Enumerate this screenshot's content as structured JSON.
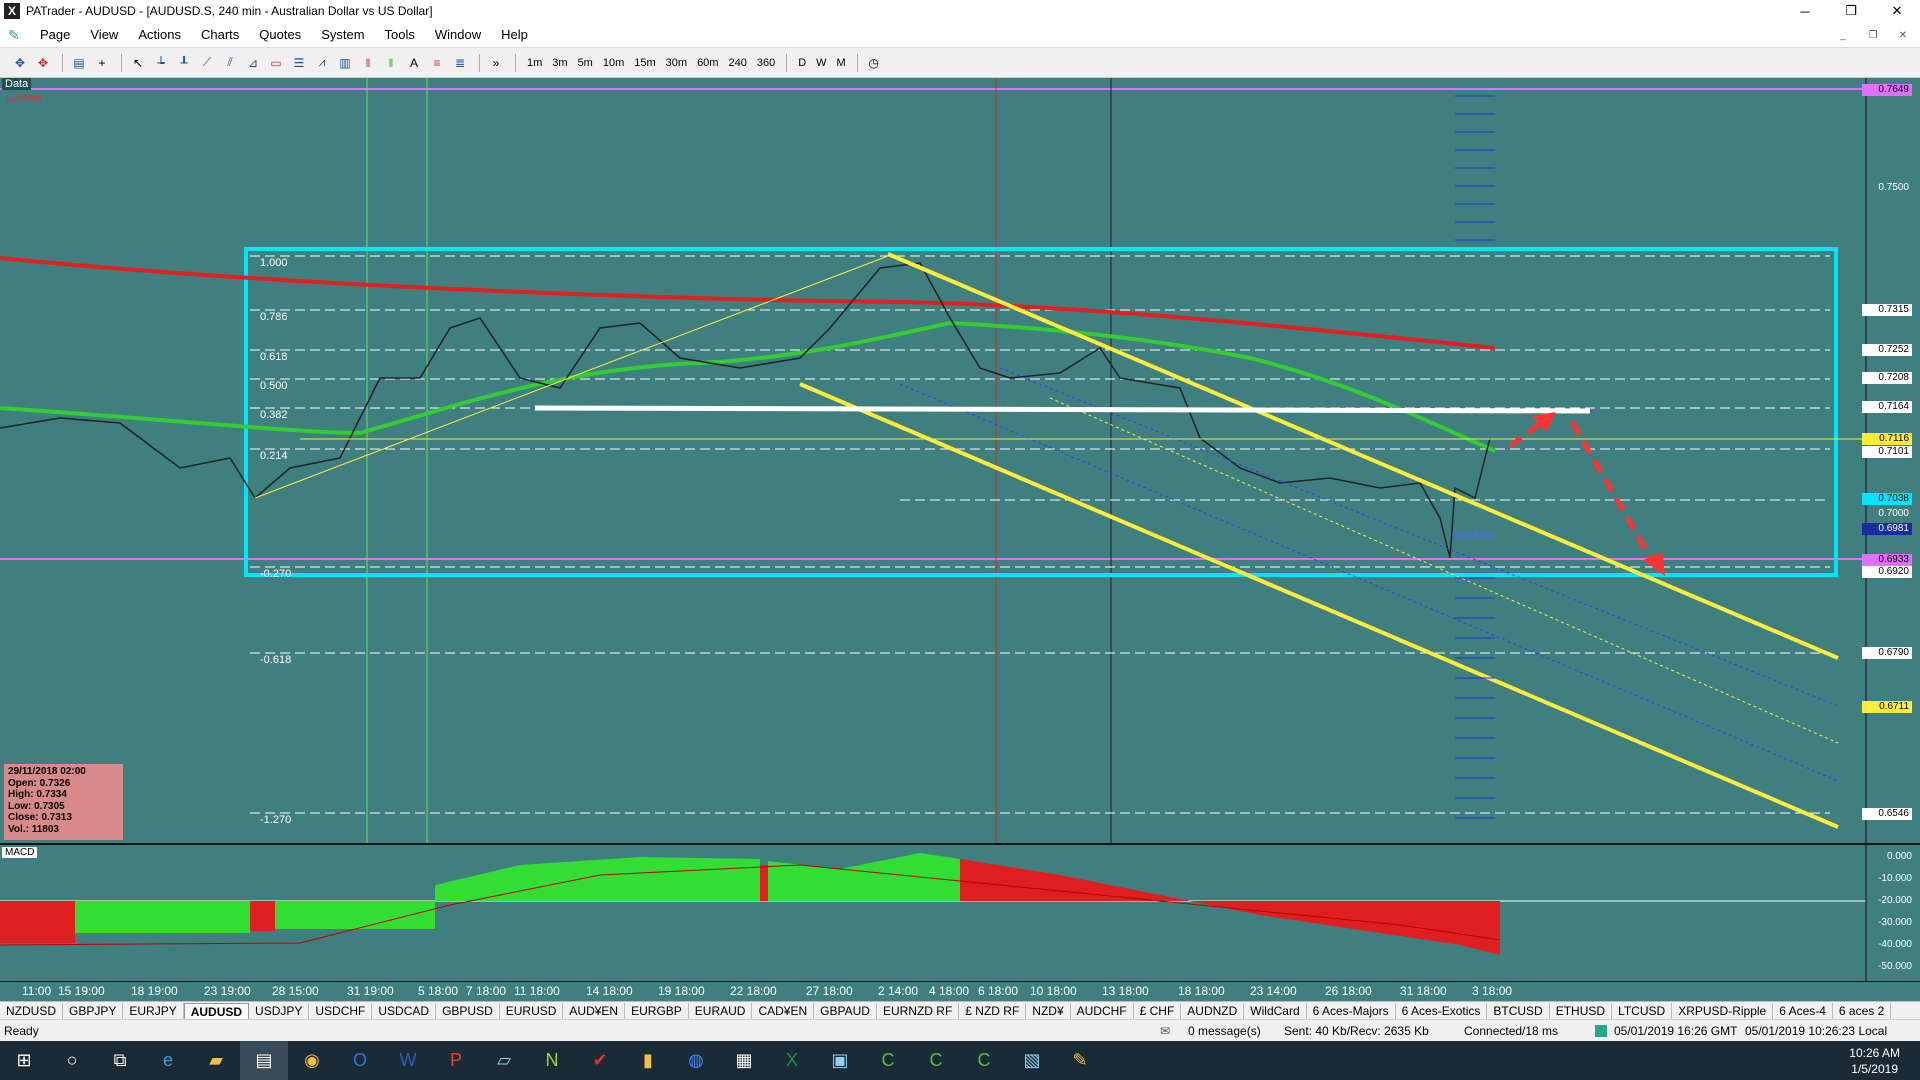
{
  "window": {
    "title": "PATrader - AUDUSD - [AUDUSD.S, 240 min - Australian Dollar vs US Dollar]",
    "app_icon_letter": "X"
  },
  "menu": [
    "Page",
    "View",
    "Actions",
    "Charts",
    "Quotes",
    "System",
    "Tools",
    "Window",
    "Help"
  ],
  "toolbar": {
    "timeframes": [
      "1m",
      "3m",
      "5m",
      "10m",
      "15m",
      "30m",
      "60m",
      "240",
      "360"
    ],
    "periods": [
      "D",
      "W",
      "M"
    ]
  },
  "chart": {
    "data_label": "Data",
    "locked_label": "Locked",
    "fib_levels": [
      "1.000",
      "0.786",
      "0.618",
      "0.500",
      "0.382",
      "0.214",
      "-0.270",
      "-0.618",
      "-1.270"
    ],
    "grid_base_label": "Grid Base",
    "price_labels": {
      "top": "0.7649",
      "p7500": "0.7500",
      "p7315": "0.7315",
      "p7252": "0.7252",
      "p7208": "0.7208",
      "p7164": "0.7164",
      "p7116": "0.7116",
      "p7101": "0.7101",
      "p7038": "0.7038",
      "p7000": "0.7000",
      "p6981": "0.6981",
      "p6933": "0.6933",
      "p6920": "0.6920",
      "p6790": "0.6790",
      "p6711": "0.6711",
      "p6546": "0.6546"
    },
    "ohlc": {
      "date": "29/11/2018 02:00",
      "open": "Open: 0.7326",
      "high": "High: 0.7334",
      "low": "Low: 0.7305",
      "close": "Close: 0.7313",
      "vol": "Vol.: 11803"
    }
  },
  "macd": {
    "title": "MACD",
    "labels": [
      "0.000",
      "-10.000",
      "-20.000",
      "-30.000",
      "-40.000",
      "-50.000"
    ]
  },
  "date_axis": [
    "11:00",
    "15 19:00",
    "18 19:00",
    "23 19:00",
    "28 15:00",
    "31 19:00",
    "5 18:00",
    "7 18:00",
    "11 18:00",
    "14 18:00",
    "19 18:00",
    "22 18:00",
    "27 18:00",
    "2 14:00",
    "4 18:00",
    "6 18:00",
    "10 18:00",
    "13 18:00",
    "18 18:00",
    "23 14:00",
    "26 18:00",
    "31 18:00",
    "3 18:00"
  ],
  "symbol_tabs": [
    "NZDUSD",
    "GBPJPY",
    "EURJPY",
    "AUDUSD",
    "USDJPY",
    "USDCHF",
    "USDCAD",
    "GBPUSD",
    "EURUSD",
    "AUD¥EN",
    "EURGBP",
    "EURAUD",
    "CAD¥EN",
    "GBPAUD",
    "EURNZD RF",
    "£ NZD RF",
    "NZD¥",
    "AUDCHF",
    "£ CHF",
    "AUDNZD",
    "WildCard",
    "6 Aces-Majors",
    "6 Aces-Exotics",
    "BTCUSD",
    "ETHUSD",
    "LTCUSD",
    "XRPUSD-Ripple",
    "6 Aces-4",
    "6 aces 2"
  ],
  "active_tab": "AUDUSD",
  "status": {
    "ready": "Ready",
    "messages": "0 message(s)",
    "traffic": "Sent: 40 Kb/Recv: 2635 Kb",
    "connection": "Connected/18 ms",
    "gmt": "05/01/2019 16:26 GMT",
    "local": "05/01/2019 10:26:23 Local"
  },
  "clock": {
    "time": "10:26 AM",
    "date": "1/5/2019"
  },
  "colors": {
    "chart_bg": "#3f7f7f",
    "fib_box": "#00e5ff",
    "channel": "#ffeb3b",
    "ma_red": "#e02020",
    "ma_green": "#33cc33",
    "pink_line": "#e070ff"
  }
}
